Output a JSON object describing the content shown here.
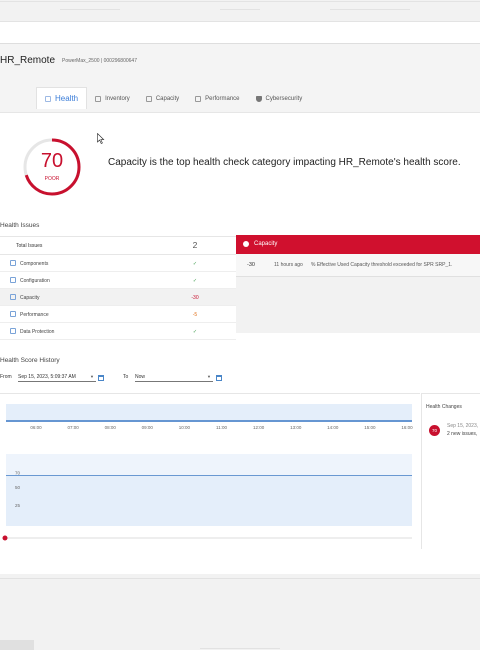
{
  "header": {
    "title": "HR_Remote",
    "subtitle": "PowerMax_2500 | 000296800647"
  },
  "tabs": [
    {
      "label": "Health",
      "icon": "health-icon",
      "active": true
    },
    {
      "label": "Inventory",
      "icon": "inventory-icon"
    },
    {
      "label": "Capacity",
      "icon": "capacity-icon"
    },
    {
      "label": "Performance",
      "icon": "performance-icon"
    },
    {
      "label": "Cybersecurity",
      "icon": "shield-icon"
    }
  ],
  "score": {
    "value": "70",
    "label": "POOR",
    "fraction": 0.7,
    "color": "#c8102e",
    "headline": "Capacity is the top health check category impacting HR_Remote's health score."
  },
  "issues": {
    "title": "Health Issues",
    "total_label": "Total Issues",
    "total_value": "2",
    "rows": [
      {
        "name": "Components",
        "value": "✓",
        "icon": "components-icon"
      },
      {
        "name": "Configuration",
        "value": "✓",
        "icon": "configuration-icon"
      },
      {
        "name": "Capacity",
        "value": "-30",
        "icon": "capacity-icon",
        "selected": true
      },
      {
        "name": "Performance",
        "value": "-5",
        "icon": "performance-icon"
      },
      {
        "name": "Data Protection",
        "value": "✓",
        "icon": "data-protection-icon"
      }
    ]
  },
  "capacity_panel": {
    "title": "Capacity",
    "row": {
      "value": "-30",
      "time": "11 hours ago",
      "description": "% Effective Used Capacity threshold exceeded for SPR SRP_1."
    }
  },
  "history": {
    "title": "Health Score History",
    "from_label": "From",
    "from_value": "Sep 15, 2023, 5:09:37 AM",
    "to_label": "To",
    "to_value": "Now",
    "changes_title": "Health Changes",
    "change": {
      "badge": "70",
      "date": "Sep 15, 2023,",
      "note": "2 new issues,"
    }
  },
  "chart_data": {
    "type": "line",
    "x_ticks": [
      "06:00",
      "07:00",
      "08:00",
      "09:00",
      "10:00",
      "11:00",
      "12:00",
      "13:00",
      "14:00",
      "15:00",
      "16:00"
    ],
    "y_ticks": [
      70,
      50,
      25
    ],
    "series": [
      {
        "values": [
          70,
          70,
          70,
          70,
          70,
          70,
          70,
          70,
          70,
          70,
          70,
          70
        ]
      }
    ],
    "ylim": [
      0,
      100
    ]
  },
  "colors": {
    "accent": "#3b7dd8",
    "danger": "#c8102e",
    "chart_fill": "#e4eefa",
    "chart_line": "#3d79c4"
  }
}
